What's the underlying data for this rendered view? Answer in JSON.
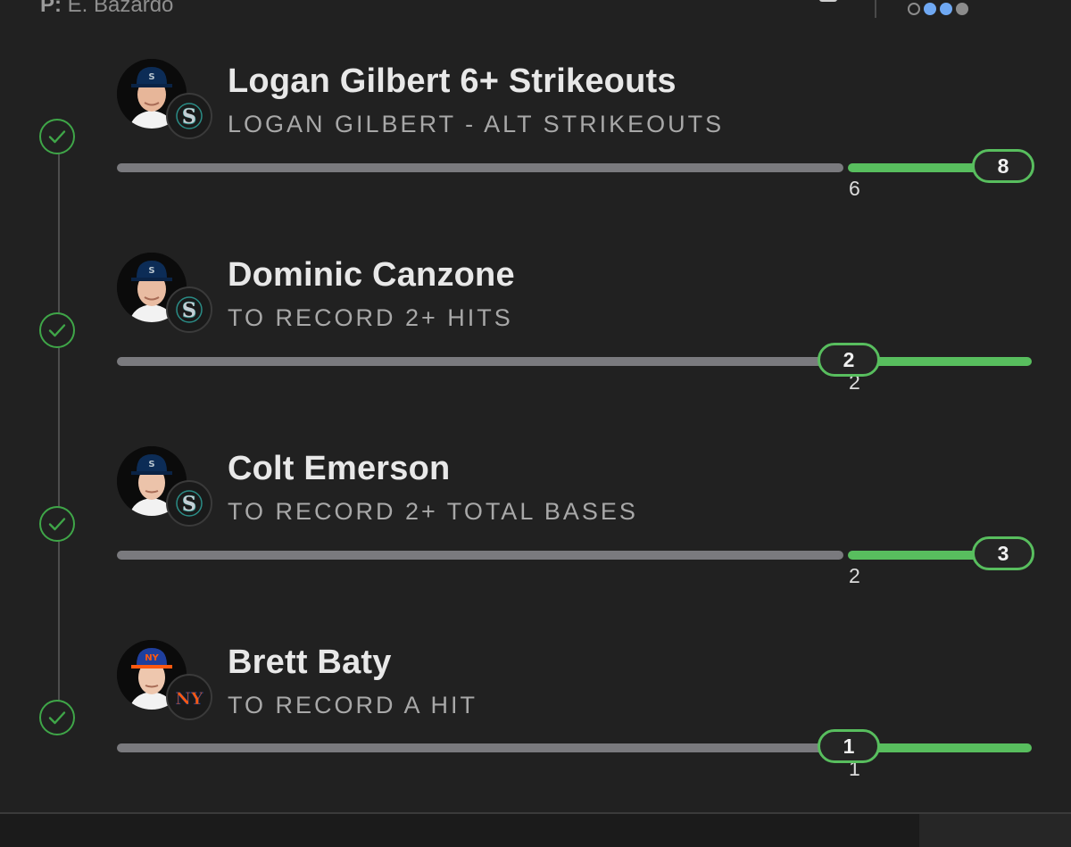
{
  "header": {
    "pitcher_prefix": "P:",
    "pitcher_name": "E. Bazardo",
    "page_dots": [
      "hollow",
      "blue",
      "blue",
      "grey"
    ]
  },
  "legs": [
    {
      "title": "Logan Gilbert 6+ Strikeouts",
      "subtitle": "LOGAN GILBERT - ALT STRIKEOUTS",
      "team": "Seattle Mariners",
      "team_logo": "S",
      "status": "won",
      "target": "6",
      "current": "8"
    },
    {
      "title": "Dominic Canzone",
      "subtitle": "TO RECORD 2+ HITS",
      "team": "Seattle Mariners",
      "team_logo": "S",
      "status": "won",
      "target": "2",
      "current": "2"
    },
    {
      "title": "Colt Emerson",
      "subtitle": "TO RECORD 2+ TOTAL BASES",
      "team": "Seattle Mariners",
      "team_logo": "S",
      "status": "won",
      "target": "2",
      "current": "3"
    },
    {
      "title": "Brett Baty",
      "subtitle": "TO RECORD A HIT",
      "team": "New York Mets",
      "team_logo": "NY",
      "status": "won",
      "target": "1",
      "current": "1"
    }
  ],
  "colors": {
    "background": "#212121",
    "success_green": "#58be5e",
    "check_green": "#3fa648",
    "track_grey": "#7a7a7e",
    "mariners_navy": "#0c2c56",
    "mariners_teal": "#2a8c86",
    "mets_blue": "#002d72",
    "mets_orange": "#ff5910"
  },
  "icons": {
    "check": "check-circle-icon",
    "mariners": "mariners-logo-icon",
    "mets": "mets-logo-icon"
  }
}
